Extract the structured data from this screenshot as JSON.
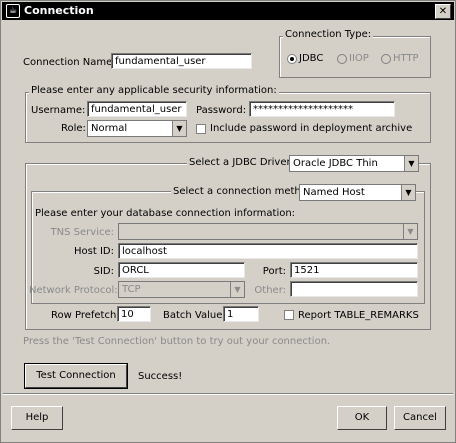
{
  "window": {
    "title": "Connection",
    "close_glyph": "✕"
  },
  "connection_name": {
    "label": "Connection Name:",
    "value": "fundamental_user"
  },
  "connection_type": {
    "title": "Connection Type:",
    "options": [
      {
        "label": "JDBC",
        "selected": true,
        "enabled": true
      },
      {
        "label": "IIOP",
        "selected": false,
        "enabled": false
      },
      {
        "label": "HTTP",
        "selected": false,
        "enabled": false
      }
    ]
  },
  "security": {
    "title": "Please enter any applicable security information:",
    "username_label": "Username:",
    "username_value": "fundamental_user",
    "password_label": "Password:",
    "password_value": "********************",
    "role_label": "Role:",
    "role_value": "Normal",
    "include_password_label": "Include password in deployment archive",
    "include_password_checked": false
  },
  "driver": {
    "label": "Select a JDBC Driver:",
    "value": "Oracle JDBC Thin"
  },
  "method": {
    "label": "Select a connection method:",
    "value": "Named Host"
  },
  "db_info": {
    "title": "Please enter your database connection information:",
    "tns_label": "TNS Service:",
    "tns_value": "",
    "host_label": "Host ID:",
    "host_value": "localhost",
    "sid_label": "SID:",
    "sid_value": "ORCL",
    "port_label": "Port:",
    "port_value": "1521",
    "protocol_label": "Network Protocol:",
    "protocol_value": "TCP",
    "other_label": "Other:",
    "other_value": ""
  },
  "row_prefetch": {
    "label": "Row Prefetch:",
    "value": "10"
  },
  "batch_value": {
    "label": "Batch Value:",
    "value": "1"
  },
  "report_table_remarks": {
    "label": "Report TABLE_REMARKS",
    "checked": false
  },
  "hint": "Press the 'Test Connection' button to try out your connection.",
  "test_connection": {
    "button_label": "Test Connection",
    "status": "Success!"
  },
  "footer": {
    "help_label": "Help",
    "ok_label": "OK",
    "cancel_label": "Cancel"
  }
}
